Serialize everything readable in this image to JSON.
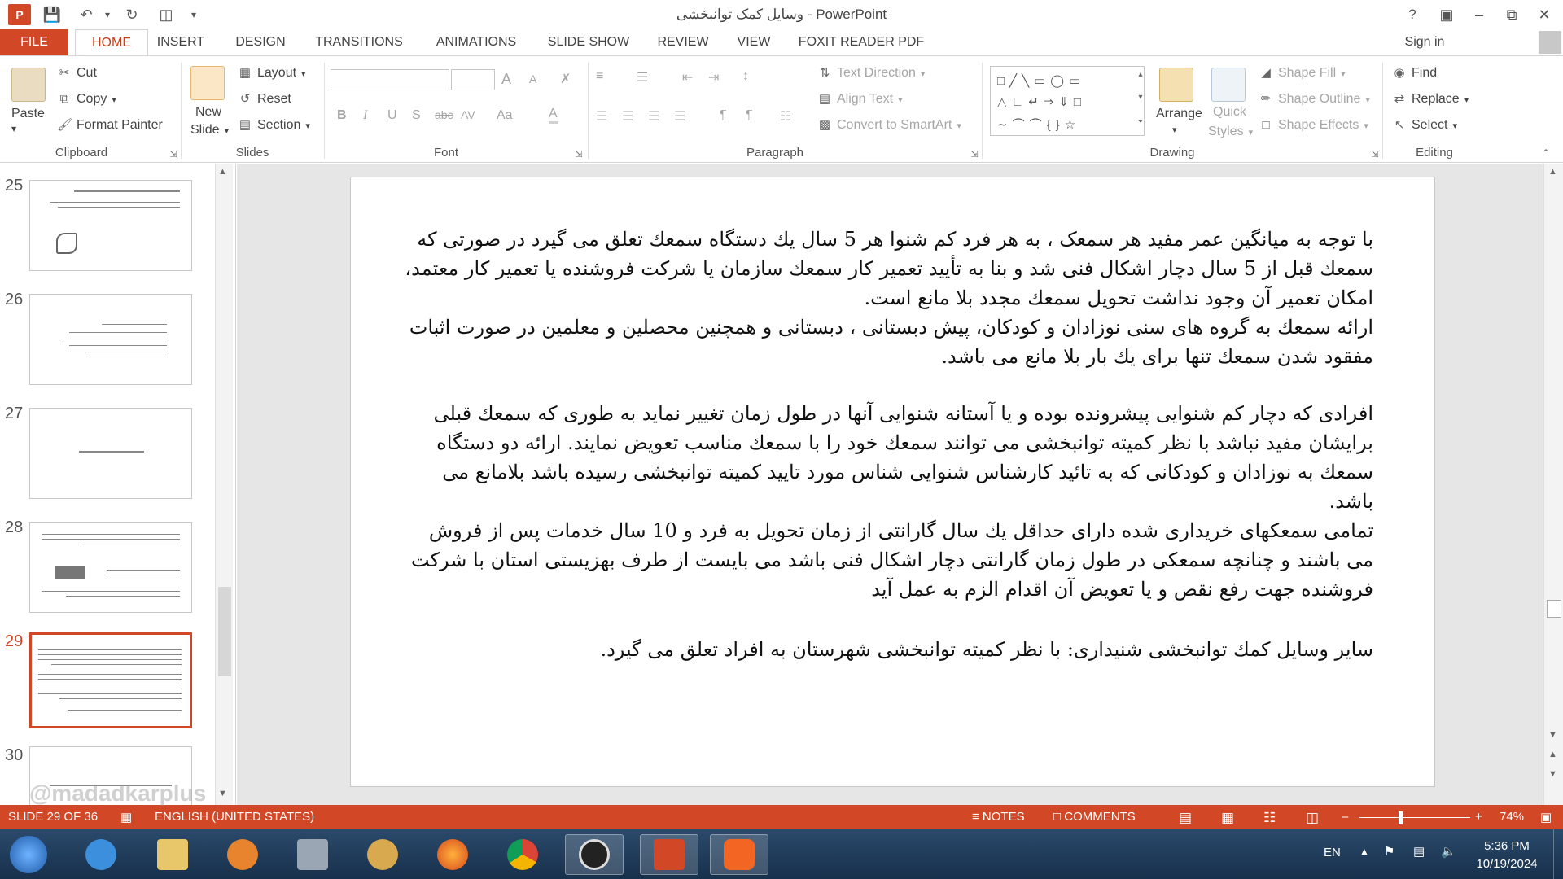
{
  "window": {
    "title": "وسایل کمک توانبخشی - PowerPoint",
    "help": "?",
    "sign_in": "Sign in"
  },
  "tabs": [
    "FILE",
    "HOME",
    "INSERT",
    "DESIGN",
    "TRANSITIONS",
    "ANIMATIONS",
    "SLIDE SHOW",
    "REVIEW",
    "VIEW",
    "FOXIT READER PDF"
  ],
  "ribbon": {
    "clipboard": {
      "label": "Clipboard",
      "paste": "Paste",
      "cut": "Cut",
      "copy": "Copy",
      "format_painter": "Format Painter"
    },
    "slides": {
      "label": "Slides",
      "new_slide_1": "New",
      "new_slide_2": "Slide",
      "layout": "Layout",
      "reset": "Reset",
      "section": "Section"
    },
    "font": {
      "label": "Font",
      "bold": "B",
      "italic": "I",
      "underline": "U",
      "shadow": "S",
      "strike": "abc",
      "spacing": "AV",
      "case": "Aa",
      "color": "A",
      "grow": "A",
      "shrink": "A"
    },
    "paragraph": {
      "label": "Paragraph",
      "text_direction": "Text Direction",
      "align_text": "Align Text",
      "convert_smartart": "Convert to SmartArt"
    },
    "drawing": {
      "label": "Drawing",
      "arrange": "Arrange",
      "quick_styles_1": "Quick",
      "quick_styles_2": "Styles",
      "shape_fill": "Shape Fill",
      "shape_outline": "Shape Outline",
      "shape_effects": "Shape Effects"
    },
    "editing": {
      "label": "Editing",
      "find": "Find",
      "replace": "Replace",
      "select": "Select"
    }
  },
  "thumbnails": [
    {
      "num": "25"
    },
    {
      "num": "26"
    },
    {
      "num": "27"
    },
    {
      "num": "28"
    },
    {
      "num": "29"
    },
    {
      "num": "30"
    }
  ],
  "slide": {
    "paragraphs": [
      "با توجه به میانگین عمر مفید هر سمعک ، به هر فرد کم شنوا هر 5 سال یك دستگاه سمعك تعلق می گیرد در صورتی که سمعك قبل از 5 سال دچار اشکال فنی شد و بنا به تأیید تعمیر کار سمعك سازمان یا شرکت فروشنده یا تعمیر کار معتمد، امکان تعمیر آن وجود نداشت تحویل سمعك مجدد بلا مانع است.",
      "ارائه سمعك به گروه های سنی نوزادان و کودکان، پیش دبستانی ، دبستانی و همچنین محصلین و معلمین در صورت اثبات مفقود شدن سمعك تنها برای یك بار بلا مانع می باشد.",
      "افرادی که دچار کم شنوایی پیشرونده بوده و یا آستانه شنوایی آنها در طول زمان تغییر نماید به طوری که سمعك قبلی برایشان مفید نباشد با نظر کمیته توانبخشی می توانند سمعك خود را با سمعك مناسب تعویض نمایند. ارائه دو دستگاه سمعك به نوزادان و کودکانی که به تائید کارشناس شنوایی شناس مورد تایید کمیته توانبخشی رسیده باشد بلامانع می باشد.",
      "تمامی سمعكهای خریداری شده دارای حداقل یك سال گارانتی از زمان تحویل به فرد و 10 سال خدمات پس از فروش می باشند و چنانچه سمعكی در طول زمان گارانتی دچار اشکال فنی باشد می بایست از طرف بهزیستی استان با شرکت فروشنده جهت رفع نقص و یا تعویض آن اقدام الزم به عمل آید",
      "سایر وسایل کمك توانبخشی شنیداری: با نظر کمیته توانبخشی شهرستان به افراد تعلق می گیرد."
    ]
  },
  "status": {
    "slide_info": "SLIDE 29 OF 36",
    "language": "ENGLISH (UNITED STATES)",
    "notes": "NOTES",
    "comments": "COMMENTS",
    "zoom": "74%",
    "zoom_fraction": 0.37,
    "watermark": "@madadkarplus"
  },
  "taskbar": {
    "lang": "EN",
    "time": "5:36 PM",
    "date": "10/19/2024"
  },
  "colors": {
    "accent": "#d24726",
    "ribbon_text": "#444444",
    "taskbar": "#1f3b5a"
  }
}
